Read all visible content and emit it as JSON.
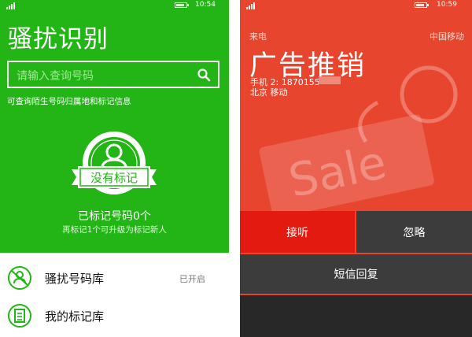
{
  "colors": {
    "green": "#22b515",
    "call_red": "#e8452f",
    "accept_red": "#e21a10",
    "dark_button": "#3c3c3c"
  },
  "left": {
    "status_bar": {
      "time": "10:54"
    },
    "title": "骚扰识别",
    "search": {
      "placeholder": "请输入查询号码",
      "icon": "search-icon"
    },
    "subtitle": "可查询陌生号码归属地和标记信息",
    "badge": {
      "label": "没有标记",
      "icon": "person-icon"
    },
    "marked_count": "已标记号码0个",
    "upgrade_hint": "再标记1个可升级为标记新人",
    "list": [
      {
        "label": "骚扰号码库",
        "status": "已开启",
        "icon": "no-person-icon"
      },
      {
        "label": "我的标记库",
        "status": "",
        "icon": "notebook-icon"
      }
    ]
  },
  "right": {
    "status_bar": {
      "time": "10:59"
    },
    "incoming_label": "来电",
    "carrier": "中国移动",
    "caller_tag": "广告推销",
    "number": "手机 2: 1870155",
    "location": "北京 移动",
    "watermark": "Sale",
    "buttons": {
      "accept": "接听",
      "ignore": "忽略",
      "sms": "短信回复"
    }
  }
}
